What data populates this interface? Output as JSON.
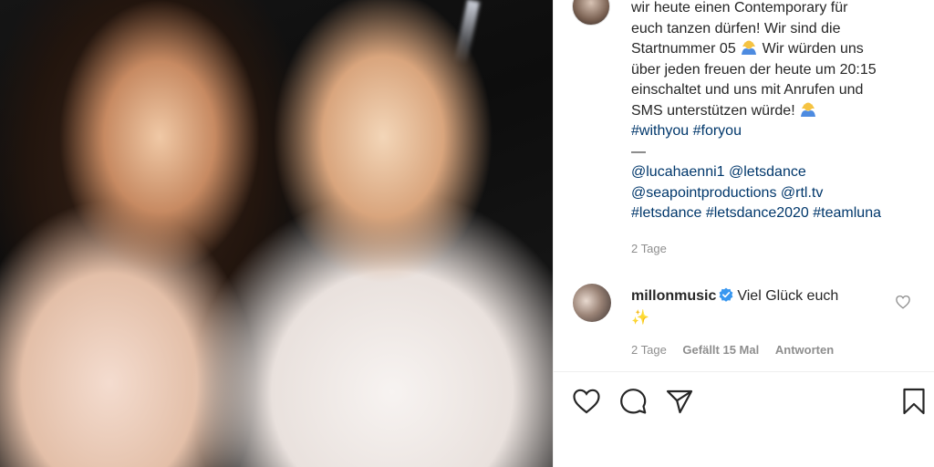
{
  "caption": {
    "lines": [
      "wir heute einen Contemporary für",
      "euch tanzen dürfen! Wir sind die",
      "Startnummer 05",
      "über jeden freuen der heute um 20:15",
      "einschaltet und uns mit Anrufen und",
      "SMS unterstützen würde!"
    ],
    "line3_rest": "Wir würden uns",
    "hashtags_line": [
      "#withyou",
      "#foryou"
    ],
    "dash": "—",
    "mentions": [
      "@lucahaenni1",
      "@letsdance",
      "@seapointproductions",
      "@rtl.tv"
    ],
    "hashtags_bottom": [
      "#letsdance",
      "#letsdance2020",
      "#teamluna"
    ],
    "emoji_icon": "raising-hands-emoji-icon"
  },
  "post_time": "2 Tage",
  "comment": {
    "username": "millonmusic",
    "text": "Viel Glück euch",
    "emoji": "✨",
    "time": "2 Tage",
    "likes": "Gefällt 15 Mal",
    "reply": "Antworten",
    "verified_icon": "verified-badge-icon",
    "like_icon": "heart-outline-icon"
  },
  "actions": {
    "like_icon": "heart-outline-icon",
    "comment_icon": "speech-bubble-icon",
    "share_icon": "paper-plane-icon",
    "save_icon": "bookmark-icon"
  },
  "colors": {
    "text": "#262626",
    "secondary": "#8e8e8e",
    "link": "#00376b",
    "verified": "#3897f0",
    "divider": "#efefef"
  }
}
